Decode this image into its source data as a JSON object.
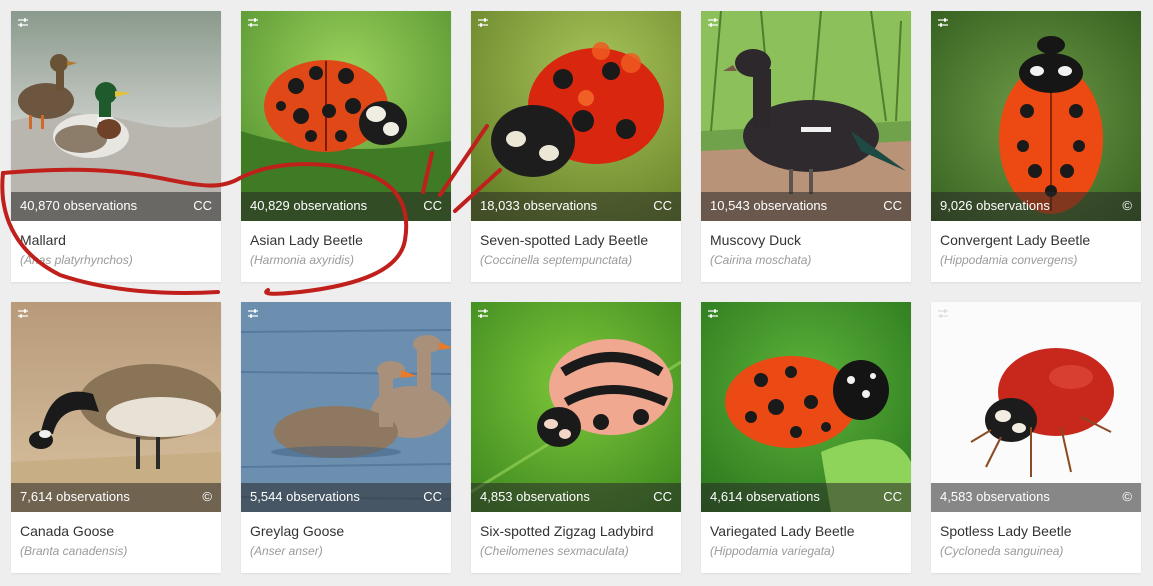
{
  "colors": {
    "background": "#eeeeee",
    "card": "#ffffff",
    "overlay": "#282828",
    "common_name": "#333333",
    "scientific_name": "#9a9a9a",
    "annotation": "#c0201c"
  },
  "taxa": [
    {
      "common": "Mallard",
      "scientific": "(Anas platyrhynchos)",
      "observations": "40,870 observations",
      "license": "CC",
      "icon": "tune-icon"
    },
    {
      "common": "Asian Lady Beetle",
      "scientific": "(Harmonia axyridis)",
      "observations": "40,829 observations",
      "license": "CC",
      "icon": "tune-icon"
    },
    {
      "common": "Seven-spotted Lady Beetle",
      "scientific": "(Coccinella septempunctata)",
      "observations": "18,033 observations",
      "license": "CC",
      "icon": "tune-icon"
    },
    {
      "common": "Muscovy Duck",
      "scientific": "(Cairina moschata)",
      "observations": "10,543 observations",
      "license": "CC",
      "icon": "tune-icon"
    },
    {
      "common": "Convergent Lady Beetle",
      "scientific": "(Hippodamia convergens)",
      "observations": "9,026 observations",
      "license": "©",
      "icon": "tune-icon"
    },
    {
      "common": "Canada Goose",
      "scientific": "(Branta canadensis)",
      "observations": "7,614 observations",
      "license": "©",
      "icon": "tune-icon"
    },
    {
      "common": "Greylag Goose",
      "scientific": "(Anser anser)",
      "observations": "5,544 observations",
      "license": "CC",
      "icon": "tune-icon"
    },
    {
      "common": "Six-spotted Zigzag Ladybird",
      "scientific": "(Cheilomenes sexmaculata)",
      "observations": "4,853 observations",
      "license": "CC",
      "icon": "tune-icon"
    },
    {
      "common": "Variegated Lady Beetle",
      "scientific": "(Hippodamia variegata)",
      "observations": "4,614 observations",
      "license": "CC",
      "icon": "tune-icon"
    },
    {
      "common": "Spotless Lady Beetle",
      "scientific": "(Cycloneda sanguinea)",
      "observations": "4,583 observations",
      "license": "©",
      "icon": "tune-icon"
    }
  ]
}
